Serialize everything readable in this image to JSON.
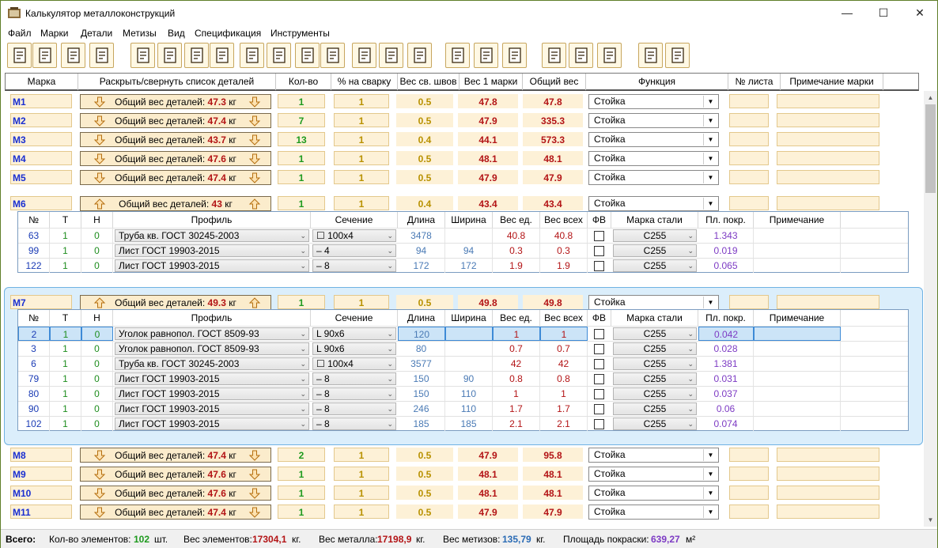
{
  "window": {
    "title": "Калькулятор металлоконструкций",
    "min": "—",
    "max": "☐",
    "close": "✕"
  },
  "menu": [
    "Файл",
    "Марки",
    "Детали",
    "Метизы",
    "Вид",
    "Спецификация",
    "Инструменты"
  ],
  "toolbar_icons": [
    "new-file-icon",
    "open-file-icon",
    "save-icon",
    "export-icon",
    "add-mark-icon",
    "delete-mark-icon",
    "mark-order-icon",
    "move-mark-icon",
    "add-detail-icon",
    "delete-detail-icon",
    "detail-order-icon",
    "move-detail-icon",
    "specification-icon",
    "sort-icon",
    "weld-icon",
    "font-az-icon",
    "line-style-icon",
    "align-icon",
    "help-icon",
    "tool-icon",
    "settings-icon",
    "excel-icon",
    "autocad-icon"
  ],
  "columns": [
    "Марка",
    "Раскрыть/свернуть список деталей",
    "Кол-во",
    "% на сварку",
    "Вес св. швов",
    "Вес 1 марки",
    "Общий вес",
    "Функция",
    "№ листа",
    "Примечание марки"
  ],
  "detail_columns": [
    "№",
    "Т",
    "Н",
    "Профиль",
    "Сечение",
    "Длина",
    "Ширина",
    "Вес ед.",
    "Вес всех",
    "ФВ",
    "Марка стали",
    "Пл. покр.",
    "Примечание"
  ],
  "expand_prefix": "Общий вес деталей:",
  "unit": "кг",
  "marks": [
    {
      "name": "M1",
      "weight": "47.3",
      "qty": "1",
      "pct": "1",
      "weld": "0.5",
      "w1": "47.8",
      "wtot": "47.8",
      "func": "Стойка",
      "expanded": false
    },
    {
      "name": "M2",
      "weight": "47.4",
      "qty": "7",
      "pct": "1",
      "weld": "0.5",
      "w1": "47.9",
      "wtot": "335.3",
      "func": "Стойка",
      "expanded": false
    },
    {
      "name": "M3",
      "weight": "43.7",
      "qty": "13",
      "pct": "1",
      "weld": "0.4",
      "w1": "44.1",
      "wtot": "573.3",
      "func": "Стойка",
      "expanded": false
    },
    {
      "name": "M4",
      "weight": "47.6",
      "qty": "1",
      "pct": "1",
      "weld": "0.5",
      "w1": "48.1",
      "wtot": "48.1",
      "func": "Стойка",
      "expanded": false
    },
    {
      "name": "M5",
      "weight": "47.4",
      "qty": "1",
      "pct": "1",
      "weld": "0.5",
      "w1": "47.9",
      "wtot": "47.9",
      "func": "Стойка",
      "expanded": false
    },
    {
      "name": "M6",
      "weight": "43",
      "qty": "1",
      "pct": "1",
      "weld": "0.4",
      "w1": "43.4",
      "wtot": "43.4",
      "func": "Стойка",
      "expanded": true,
      "details": [
        {
          "no": "63",
          "t": "1",
          "n": "0",
          "profile": "Труба кв. ГОСТ 30245-2003",
          "section": "☐ 100x4",
          "len": "3478",
          "width": "",
          "wu": "40.8",
          "wall": "40.8",
          "steel": "С255",
          "paint": "1.343",
          "note": ""
        },
        {
          "no": "99",
          "t": "1",
          "n": "0",
          "profile": "Лист ГОСТ 19903-2015",
          "section": "– 4",
          "len": "94",
          "width": "94",
          "wu": "0.3",
          "wall": "0.3",
          "steel": "С255",
          "paint": "0.019",
          "note": ""
        },
        {
          "no": "122",
          "t": "1",
          "n": "0",
          "profile": "Лист ГОСТ 19903-2015",
          "section": "– 8",
          "len": "172",
          "width": "172",
          "wu": "1.9",
          "wall": "1.9",
          "steel": "С255",
          "paint": "0.065",
          "note": ""
        }
      ]
    },
    {
      "name": "M7",
      "weight": "49.3",
      "qty": "1",
      "pct": "1",
      "weld": "0.5",
      "w1": "49.8",
      "wtot": "49.8",
      "func": "Стойка",
      "expanded": true,
      "selected": true,
      "details": [
        {
          "no": "2",
          "t": "1",
          "n": "0",
          "profile": "Уголок равнопол. ГОСТ 8509-93",
          "section": "L 90x6",
          "len": "120",
          "width": "",
          "wu": "1",
          "wall": "1",
          "steel": "С255",
          "paint": "0.042",
          "note": "",
          "selected": true
        },
        {
          "no": "3",
          "t": "1",
          "n": "0",
          "profile": "Уголок равнопол. ГОСТ 8509-93",
          "section": "L 90x6",
          "len": "80",
          "width": "",
          "wu": "0.7",
          "wall": "0.7",
          "steel": "С255",
          "paint": "0.028",
          "note": ""
        },
        {
          "no": "6",
          "t": "1",
          "n": "0",
          "profile": "Труба кв. ГОСТ 30245-2003",
          "section": "☐ 100x4",
          "len": "3577",
          "width": "",
          "wu": "42",
          "wall": "42",
          "steel": "С255",
          "paint": "1.381",
          "note": ""
        },
        {
          "no": "79",
          "t": "1",
          "n": "0",
          "profile": "Лист ГОСТ 19903-2015",
          "section": "– 8",
          "len": "150",
          "width": "90",
          "wu": "0.8",
          "wall": "0.8",
          "steel": "С255",
          "paint": "0.031",
          "note": ""
        },
        {
          "no": "80",
          "t": "1",
          "n": "0",
          "profile": "Лист ГОСТ 19903-2015",
          "section": "– 8",
          "len": "150",
          "width": "110",
          "wu": "1",
          "wall": "1",
          "steel": "С255",
          "paint": "0.037",
          "note": ""
        },
        {
          "no": "90",
          "t": "1",
          "n": "0",
          "profile": "Лист ГОСТ 19903-2015",
          "section": "– 8",
          "len": "246",
          "width": "110",
          "wu": "1.7",
          "wall": "1.7",
          "steel": "С255",
          "paint": "0.06",
          "note": ""
        },
        {
          "no": "102",
          "t": "1",
          "n": "0",
          "profile": "Лист ГОСТ 19903-2015",
          "section": "– 8",
          "len": "185",
          "width": "185",
          "wu": "2.1",
          "wall": "2.1",
          "steel": "С255",
          "paint": "0.074",
          "note": ""
        }
      ]
    },
    {
      "name": "M8",
      "weight": "47.4",
      "qty": "2",
      "pct": "1",
      "weld": "0.5",
      "w1": "47.9",
      "wtot": "95.8",
      "func": "Стойка",
      "expanded": false
    },
    {
      "name": "M9",
      "weight": "47.6",
      "qty": "1",
      "pct": "1",
      "weld": "0.5",
      "w1": "48.1",
      "wtot": "48.1",
      "func": "Стойка",
      "expanded": false
    },
    {
      "name": "M10",
      "weight": "47.6",
      "qty": "1",
      "pct": "1",
      "weld": "0.5",
      "w1": "48.1",
      "wtot": "48.1",
      "func": "Стойка",
      "expanded": false
    },
    {
      "name": "M11",
      "weight": "47.4",
      "qty": "1",
      "pct": "1",
      "weld": "0.5",
      "w1": "47.9",
      "wtot": "47.9",
      "func": "Стойка",
      "expanded": false
    }
  ],
  "status": {
    "total_label": "Всего:",
    "elements_label": "Кол-во элементов:",
    "elements_value": "102",
    "elements_unit": "шт.",
    "weight_label": "Вес элементов:",
    "weight_value": "17304,1",
    "weight_unit": "кг.",
    "metal_label": "Вес металла:",
    "metal_value": "17198,9",
    "metal_unit": "кг.",
    "fasteners_label": "Вес метизов:",
    "fasteners_value": "135,79",
    "fasteners_unit": "кг.",
    "paint_label": "Площадь покраски:",
    "paint_value": "639,27",
    "paint_unit": "м²"
  },
  "colors": {
    "accent_border": "#5f7e2a",
    "cell_bg": "#fdf1d7",
    "mark_name": "#1a2fd1",
    "weight_red": "#b31416",
    "qty_green": "#1e9a1e",
    "pct_gold": "#b89100",
    "selection_panel": "#dbeefb"
  }
}
